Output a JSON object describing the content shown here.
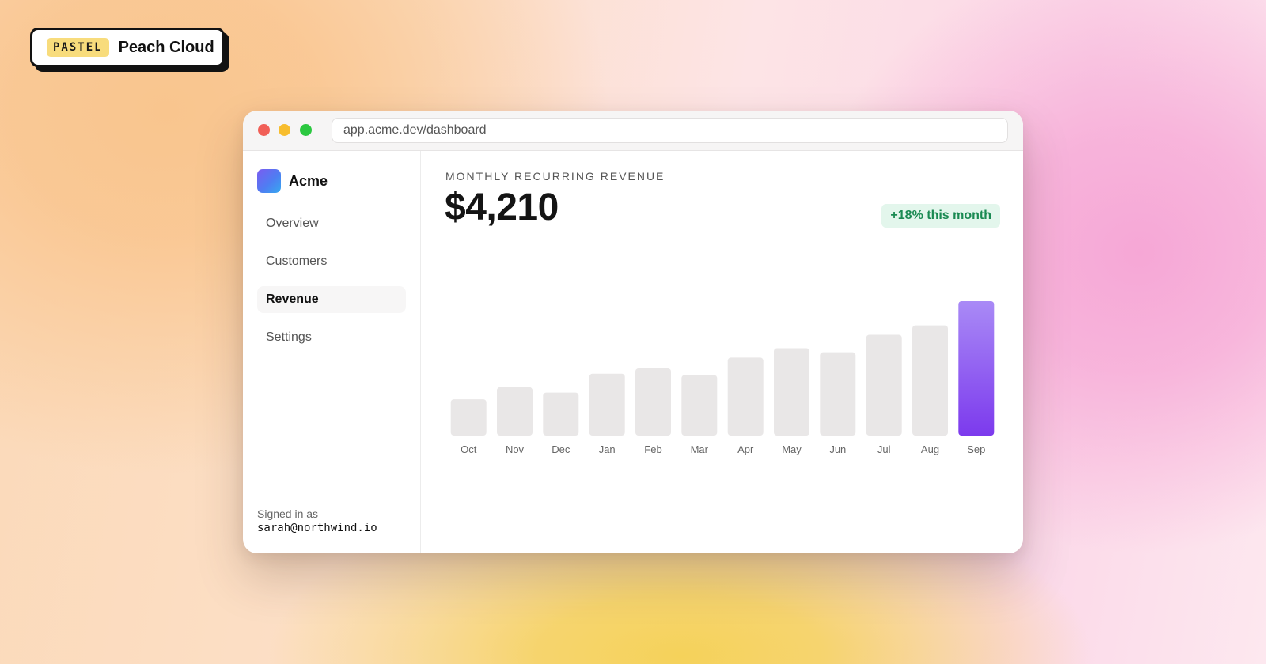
{
  "brand_tag": {
    "pill": "PASTEL",
    "name": "Peach Cloud"
  },
  "window": {
    "url": "app.acme.dev/dashboard"
  },
  "sidebar": {
    "brand": "Acme",
    "items": [
      {
        "label": "Overview",
        "active": false
      },
      {
        "label": "Customers",
        "active": false
      },
      {
        "label": "Revenue",
        "active": true
      },
      {
        "label": "Settings",
        "active": false
      }
    ],
    "signed_in_label": "Signed in as",
    "signed_in_email": "sarah@northwind.io"
  },
  "main": {
    "metric_label": "MONTHLY RECURRING REVENUE",
    "metric_value": "$4,210",
    "delta": "+18% this month"
  },
  "colors": {
    "bar": "#e9e7e7",
    "highlight_top": "#a98af6",
    "highlight_bottom": "#7c3aed",
    "axis": "#eeeeee",
    "tick_text": "#666666"
  },
  "chart_data": {
    "type": "bar",
    "categories": [
      "Oct",
      "Nov",
      "Dec",
      "Jan",
      "Feb",
      "Mar",
      "Apr",
      "May",
      "Jun",
      "Jul",
      "Aug",
      "Sep"
    ],
    "values": [
      27,
      36,
      32,
      46,
      50,
      45,
      58,
      65,
      62,
      75,
      82,
      100
    ],
    "highlight_index": 11,
    "ylim": [
      0,
      100
    ],
    "grid": false,
    "legend": "none"
  }
}
